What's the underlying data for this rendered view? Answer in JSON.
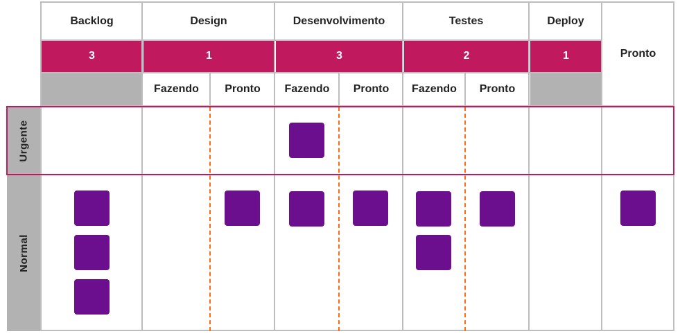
{
  "columns": [
    {
      "name": "Backlog",
      "wip": "3"
    },
    {
      "name": "Design",
      "wip": "1",
      "sub": [
        "Fazendo",
        "Pronto"
      ]
    },
    {
      "name": "Desenvolvimento",
      "wip": "3",
      "sub": [
        "Fazendo",
        "Pronto"
      ]
    },
    {
      "name": "Testes",
      "wip": "2",
      "sub": [
        "Fazendo",
        "Pronto"
      ]
    },
    {
      "name": "Deploy",
      "wip": "1"
    },
    {
      "name": "Pronto"
    }
  ],
  "lanes": {
    "urgent": "Urgente",
    "normal": "Normal"
  },
  "colors": {
    "wip_bar": "#c0195e",
    "card": "#6c0f8e",
    "divider_dashed": "#ff6a13",
    "gray_header": "#b2b2b2",
    "urgent_frame": "#c0195e"
  }
}
